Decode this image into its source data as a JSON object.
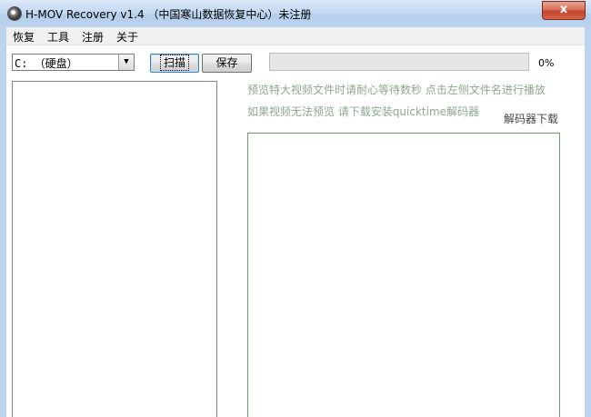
{
  "window": {
    "title": "H-MOV Recovery v1.4 （中国寒山数据恢复中心）未注册",
    "close_label": "x"
  },
  "menu": {
    "items": [
      "恢复",
      "工具",
      "注册",
      "关于"
    ]
  },
  "toolbar": {
    "drive_value": "C: （硬盘）",
    "scan_label": "扫描",
    "save_label": "保存",
    "progress_percent": 0,
    "progress_text": "0%"
  },
  "tips": {
    "line1": "预览特大视频文件时请耐心等待数秒 点击左侧文件名进行播放",
    "line2": "如果视频无法预览 请下载安装quicktime解码器",
    "decoder_link": "解码器下载"
  },
  "colors": {
    "tip_text": "#8fa88f",
    "preview_border": "#6e9a6e"
  }
}
